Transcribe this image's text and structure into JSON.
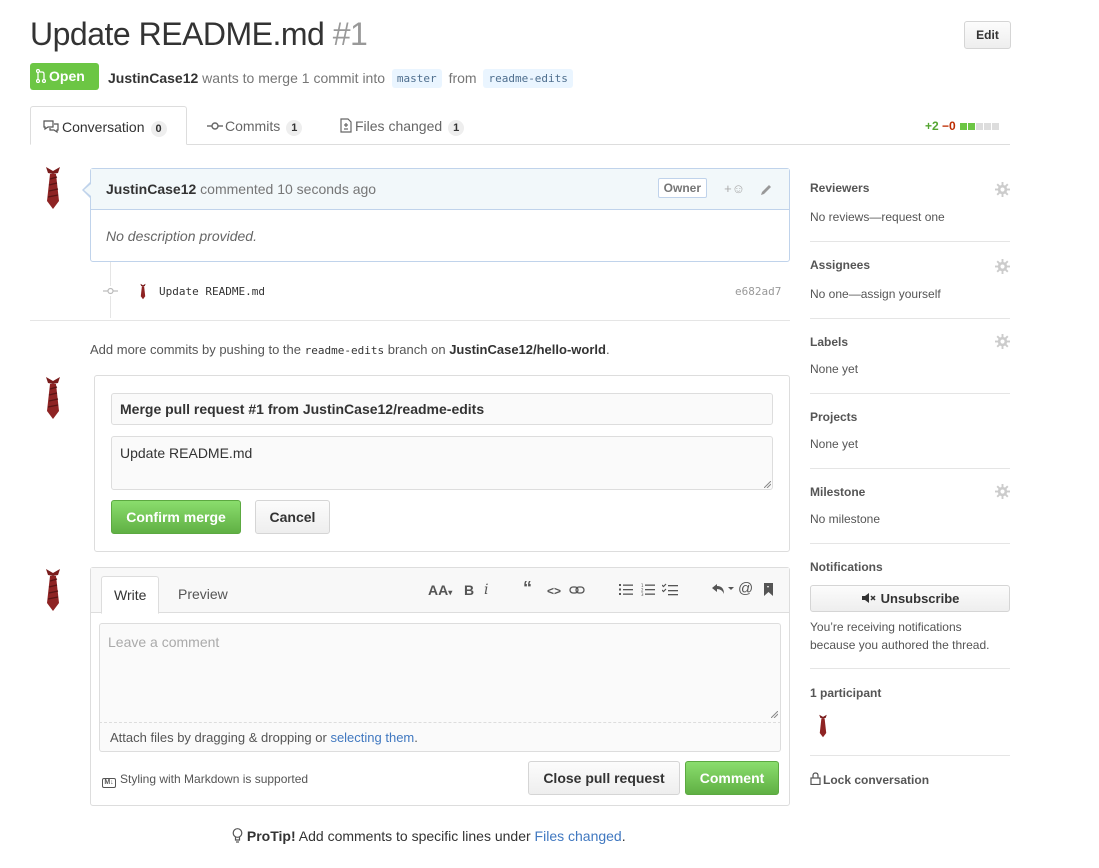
{
  "header": {
    "title": "Update README.md",
    "number": "#1",
    "edit_label": "Edit",
    "state_label": "Open",
    "author": "JustinCase12",
    "merge_text": "wants to merge 1 commit into",
    "base_branch": "master",
    "from_text": "from",
    "head_branch": "readme-edits"
  },
  "tabs": [
    {
      "label": "Conversation",
      "count": "0"
    },
    {
      "label": "Commits",
      "count": "1"
    },
    {
      "label": "Files changed",
      "count": "1"
    }
  ],
  "diffstat": {
    "additions": "+2",
    "deletions": "−0"
  },
  "comment": {
    "author": "JustinCase12",
    "action": "commented 10 seconds ago",
    "owner_label": "Owner",
    "body": "No description provided."
  },
  "commit": {
    "message": "Update README.md",
    "sha": "e682ad7"
  },
  "push_note": {
    "prefix": "Add more commits by pushing to the",
    "branch": "readme-edits",
    "middle": "branch on",
    "repo": "JustinCase12/hello-world",
    "suffix": "."
  },
  "merge": {
    "title": "Merge pull request #1 from JustinCase12/readme-edits",
    "message": "Update README.md",
    "confirm_label": "Confirm merge",
    "cancel_label": "Cancel"
  },
  "writer": {
    "write_tab": "Write",
    "preview_tab": "Preview",
    "placeholder": "Leave a comment",
    "attach_prefix": "Attach files by dragging & dropping or",
    "attach_link": "selecting them",
    "attach_suffix": ".",
    "markdown_note": "Styling with Markdown is supported",
    "close_label": "Close pull request",
    "comment_label": "Comment"
  },
  "protip": {
    "label": "ProTip!",
    "text": "Add comments to specific lines under",
    "link": "Files changed",
    "suffix": "."
  },
  "sidebar": {
    "reviewers": {
      "heading": "Reviewers",
      "value": "No reviews—request one"
    },
    "assignees": {
      "heading": "Assignees",
      "value": "No one—assign yourself"
    },
    "labels": {
      "heading": "Labels",
      "value": "None yet"
    },
    "projects": {
      "heading": "Projects",
      "value": "None yet"
    },
    "milestone": {
      "heading": "Milestone",
      "value": "No milestone"
    },
    "notifications": {
      "heading": "Notifications",
      "button": "Unsubscribe",
      "line1": "You’re receiving notifications",
      "line2": "because you authored the thread."
    },
    "participants": {
      "heading": "1 participant"
    },
    "lock": "Lock conversation"
  },
  "colors": {
    "open_green": "#6cc644",
    "link_blue": "#4078c0",
    "deletion_red": "#bd2c00"
  }
}
